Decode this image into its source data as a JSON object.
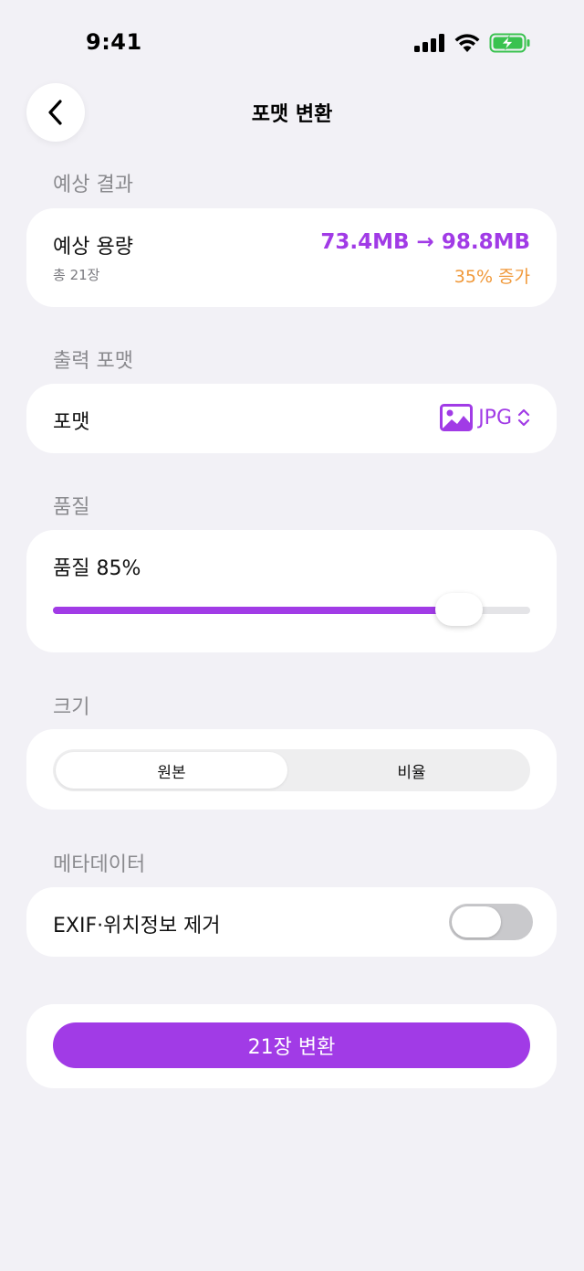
{
  "status_bar": {
    "time": "9:41"
  },
  "header": {
    "title": "포맷 변환"
  },
  "sections": {
    "estimate_label": "예상 결과",
    "output_label": "출력 포맷",
    "quality_label": "품질",
    "size_label": "크기",
    "metadata_label": "메타데이터"
  },
  "estimate": {
    "title": "예상 용량",
    "count": "총 21장",
    "sizes": "73.4MB → 98.8MB",
    "change": "35% 증가"
  },
  "format": {
    "label": "포맷",
    "value": "JPG",
    "icon": "photo-icon"
  },
  "quality": {
    "label": "품질 85%",
    "value": 0.85
  },
  "size": {
    "options": [
      "원본",
      "비율"
    ],
    "selected": "원본"
  },
  "metadata": {
    "label": "EXIF·위치정보 제거",
    "enabled": false
  },
  "action": {
    "button_label": "21장 변환"
  },
  "colors": {
    "accent": "#a13be6",
    "warning": "#f0993a",
    "background": "#f2f1f6"
  }
}
